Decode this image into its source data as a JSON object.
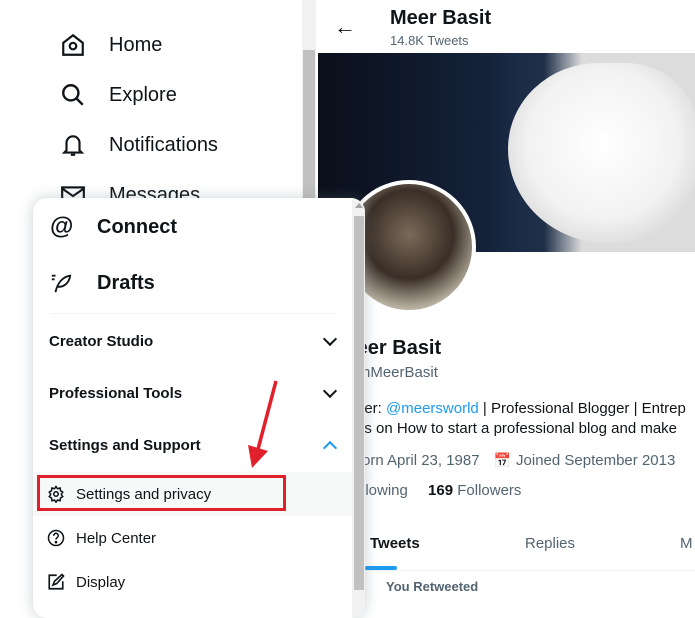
{
  "sidebar": {
    "items": [
      {
        "label": "Home",
        "icon": "home-icon"
      },
      {
        "label": "Explore",
        "icon": "search-icon"
      },
      {
        "label": "Notifications",
        "icon": "bell-icon"
      },
      {
        "label": "Messages",
        "icon": "mail-icon"
      }
    ]
  },
  "menu": {
    "connect": "Connect",
    "drafts": "Drafts",
    "creator_studio": "Creator Studio",
    "professional_tools": "Professional Tools",
    "settings_support": "Settings and Support",
    "settings_privacy": "Settings and privacy",
    "help_center": "Help Center",
    "display": "Display"
  },
  "profile": {
    "header_name": "Meer Basit",
    "tweet_count": "14.8K Tweets",
    "name": "Meer Basit",
    "handle_visible": "nMeerBasit",
    "bio_prefix": "der: ",
    "bio_link": "@meersworld",
    "bio_rest": " | Professional Blogger | Entrep",
    "bio_line2": "es on How to start a professional blog and make",
    "born": "orn April 23, 1987",
    "joined": "Joined September 2013",
    "following": "llowing",
    "followers_count": "169",
    "followers_label": " Followers"
  },
  "tabs": [
    "Tweets",
    "Replies",
    "M"
  ],
  "feed": {
    "retweet_label": "You Retweeted"
  },
  "colors": {
    "accent": "#1d9bf0",
    "highlight": "#e0202a"
  }
}
